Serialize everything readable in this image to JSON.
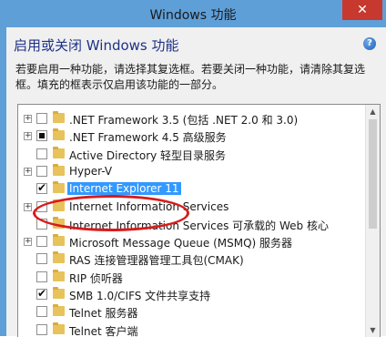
{
  "window": {
    "title": "Windows 功能",
    "close_label": "✕"
  },
  "header": {
    "heading": "启用或关闭 Windows 功能",
    "help_label": "?",
    "description": "若要启用一种功能，请选择其复选框。若要关闭一种功能，请清除其复选框。填充的框表示仅启用该功能的一部分。"
  },
  "features": [
    {
      "label": ".NET Framework 3.5 (包括 .NET 2.0 和 3.0)",
      "expandable": true,
      "state": "unchecked"
    },
    {
      "label": ".NET Framework 4.5 高级服务",
      "expandable": true,
      "state": "partial"
    },
    {
      "label": "Active Directory 轻型目录服务",
      "expandable": false,
      "state": "unchecked"
    },
    {
      "label": "Hyper-V",
      "expandable": true,
      "state": "unchecked"
    },
    {
      "label": "Internet Explorer 11",
      "expandable": false,
      "state": "checked",
      "selected": true
    },
    {
      "label": "Internet Information Services",
      "expandable": true,
      "state": "unchecked"
    },
    {
      "label": "Internet Information Services 可承载的 Web 核心",
      "expandable": false,
      "state": "unchecked"
    },
    {
      "label": "Microsoft Message Queue (MSMQ) 服务器",
      "expandable": true,
      "state": "unchecked"
    },
    {
      "label": "RAS 连接管理器管理工具包(CMAK)",
      "expandable": false,
      "state": "unchecked"
    },
    {
      "label": "RIP 侦听器",
      "expandable": false,
      "state": "unchecked"
    },
    {
      "label": "SMB 1.0/CIFS 文件共享支持",
      "expandable": false,
      "state": "checked"
    },
    {
      "label": "Telnet 服务器",
      "expandable": false,
      "state": "unchecked"
    },
    {
      "label": "Telnet 客户端",
      "expandable": false,
      "state": "unchecked"
    }
  ],
  "icons": {
    "folder": "folder-icon",
    "help": "help-icon",
    "close": "close-icon"
  },
  "colors": {
    "titlebar": "#5f9fd8",
    "close": "#c7392e",
    "selection": "#3399ff",
    "annotation": "#d81b1b",
    "heading": "#1e3287"
  }
}
